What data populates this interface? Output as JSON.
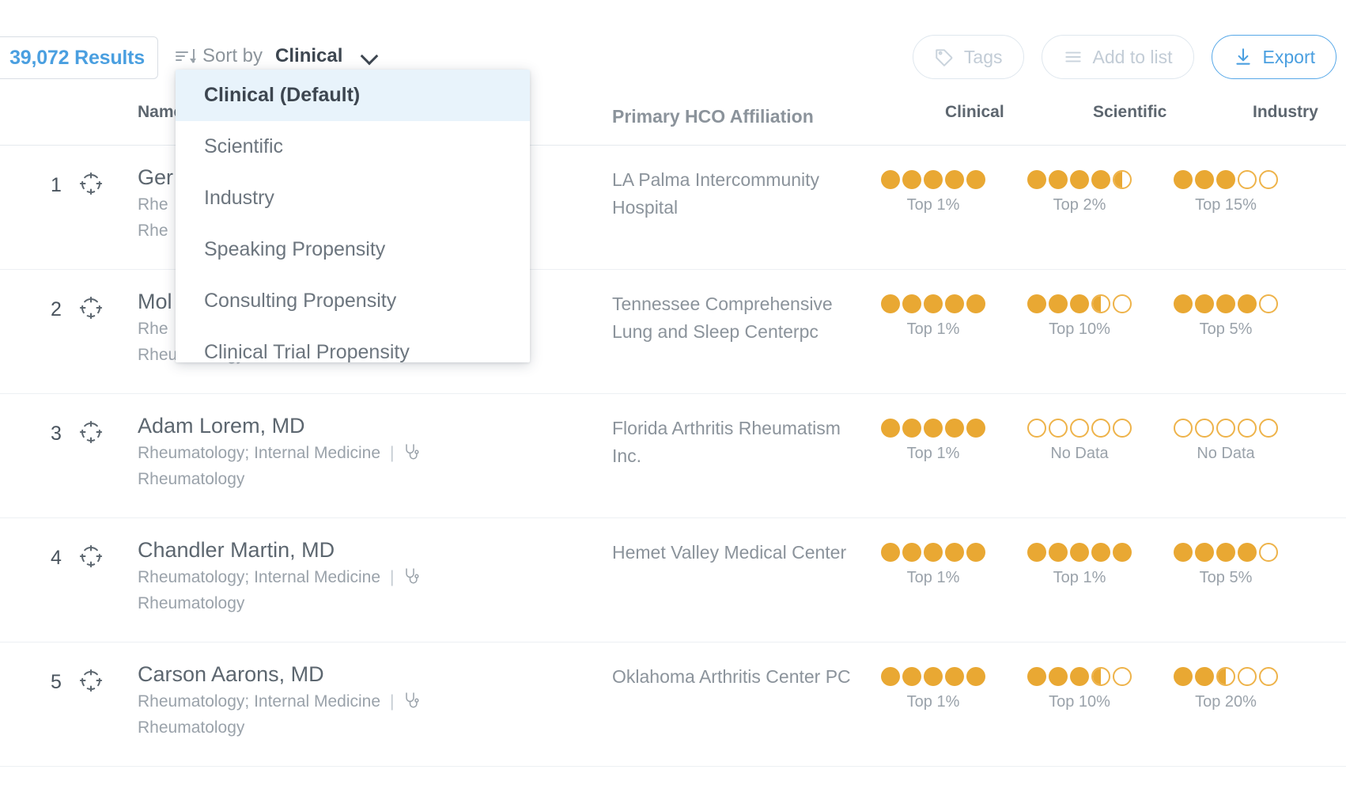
{
  "toolbar": {
    "results_count": "39,072 Results",
    "sort_by_label": "Sort by",
    "sort_value": "Clinical",
    "sort_icon": "sort-descending-icon",
    "chevron_icon": "chevron-down-icon",
    "buttons": [
      {
        "label": "Tags",
        "icon": "tag-icon",
        "style": "muted"
      },
      {
        "label": "Add to list",
        "icon": "list-icon",
        "style": "muted"
      },
      {
        "label": "Export",
        "icon": "download-icon",
        "style": "primary"
      }
    ]
  },
  "sort_dropdown": {
    "open": true,
    "items": [
      {
        "label": "Clinical (Default)",
        "selected": true
      },
      {
        "label": "Scientific",
        "selected": false
      },
      {
        "label": "Industry",
        "selected": false
      },
      {
        "label": "Speaking Propensity",
        "selected": false
      },
      {
        "label": "Consulting Propensity",
        "selected": false
      },
      {
        "label": "Clinical Trial Propensity",
        "selected": false
      }
    ]
  },
  "table": {
    "columns": [
      {
        "key": "name",
        "label": "Name"
      },
      {
        "key": "hco",
        "label": "Primary HCO Affiliation"
      },
      {
        "key": "clinical",
        "label": "Clinical"
      },
      {
        "key": "scientific",
        "label": "Scientific"
      },
      {
        "key": "industry",
        "label": "Industry"
      }
    ],
    "rows": [
      {
        "rank": "1",
        "name": "Ger",
        "specialty": "Rhe",
        "specialty2": "Rhe",
        "hco": "LA Palma Intercommunity Hospital",
        "clinical": {
          "filled": 5,
          "half": 0,
          "label": "Top 1%"
        },
        "scientific": {
          "filled": 4,
          "half": 1,
          "label": "Top 2%"
        },
        "industry": {
          "filled": 3,
          "half": 0,
          "label": "Top 15%"
        }
      },
      {
        "rank": "2",
        "name": "Mol",
        "specialty": "Rhe",
        "specialty2": "Rheumatology",
        "hco": "Tennessee Comprehensive Lung and Sleep Centerpc",
        "clinical": {
          "filled": 5,
          "half": 0,
          "label": "Top 1%"
        },
        "scientific": {
          "filled": 3,
          "half": 1,
          "label": "Top 10%"
        },
        "industry": {
          "filled": 4,
          "half": 0,
          "label": "Top 5%"
        }
      },
      {
        "rank": "3",
        "name": "Adam Lorem, MD",
        "specialty": "Rheumatology; Internal Medicine",
        "specialty2": "Rheumatology",
        "hco": "Florida Arthritis Rheumatism Inc.",
        "clinical": {
          "filled": 5,
          "half": 0,
          "label": "Top 1%"
        },
        "scientific": {
          "filled": 0,
          "half": 0,
          "label": "No Data"
        },
        "industry": {
          "filled": 0,
          "half": 0,
          "label": "No Data"
        }
      },
      {
        "rank": "4",
        "name": "Chandler Martin, MD",
        "specialty": "Rheumatology; Internal Medicine",
        "specialty2": "Rheumatology",
        "hco": "Hemet Valley Medical Center",
        "clinical": {
          "filled": 5,
          "half": 0,
          "label": "Top 1%"
        },
        "scientific": {
          "filled": 5,
          "half": 0,
          "label": "Top 1%"
        },
        "industry": {
          "filled": 4,
          "half": 0,
          "label": "Top 5%"
        }
      },
      {
        "rank": "5",
        "name": "Carson Aarons, MD",
        "specialty": "Rheumatology; Internal Medicine",
        "specialty2": "Rheumatology",
        "hco": "Oklahoma Arthritis Center PC",
        "clinical": {
          "filled": 5,
          "half": 0,
          "label": "Top 1%"
        },
        "scientific": {
          "filled": 3,
          "half": 1,
          "label": "Top 10%"
        },
        "industry": {
          "filled": 2,
          "half": 1,
          "label": "Top 20%"
        }
      }
    ]
  },
  "colors": {
    "accent_blue": "#4a9fe0",
    "rating_orange": "#e9a833",
    "rating_outline": "#eeb34a",
    "text_dark": "#3d4650",
    "text_muted": "#9aa2aa",
    "row_border": "#edf0f3",
    "highlight_bg": "#e8f3fb"
  }
}
